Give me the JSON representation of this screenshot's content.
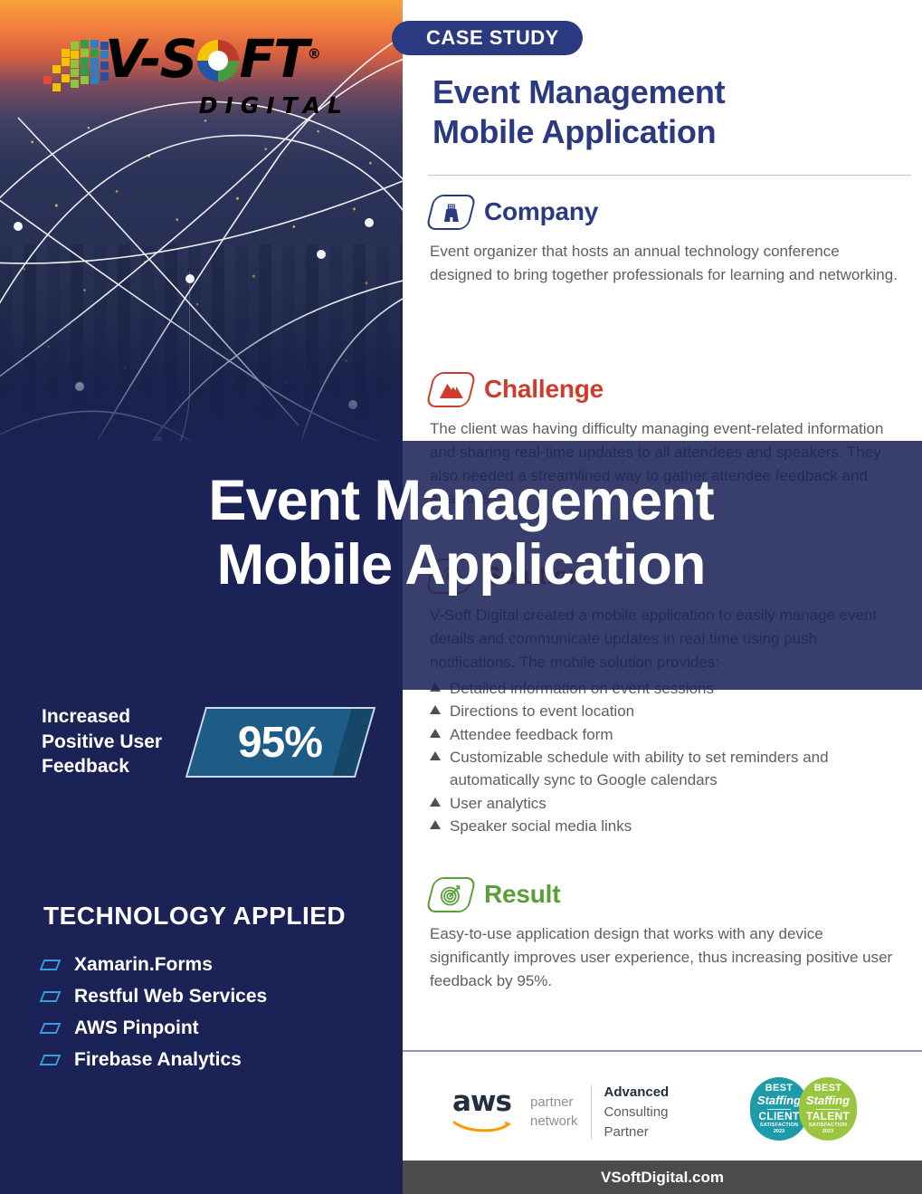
{
  "brand": {
    "logo_name": "V-SOFT",
    "logo_sub": "DIGITAL",
    "registered_mark": "®"
  },
  "overlay": {
    "title_line1": "Event Management",
    "title_line2": "Mobile Application"
  },
  "header": {
    "badge": "CASE STUDY",
    "title_line1": "Event Management",
    "title_line2": "Mobile Application"
  },
  "sections": [
    {
      "id": "company",
      "icon": "building-icon",
      "title": "Company",
      "color": "#2b3a80",
      "body": "Event organizer that hosts an annual technology conference designed to bring together professionals for learning and networking."
    },
    {
      "id": "challenge",
      "icon": "mountain-icon",
      "title": "Challenge",
      "color": "#cf3b2c",
      "body": "The client was having difficulty managing event-related information and sharing real-time updates to all attendees and speakers. They also needed a streamlined way to gather attendee feedback and analytics."
    },
    {
      "id": "solution",
      "icon": "lightbulb-icon",
      "title": "Solution",
      "color": "#d1512c",
      "body": "V-Soft Digital created a mobile application to easily manage event details and communicate updates in real time using push notifications. The mobile solution provides:"
    },
    {
      "id": "result",
      "icon": "target-icon",
      "title": "Result",
      "color": "#5a9e3a",
      "body": "Easy-to-use application design that works with any device significantly improves user experience, thus increasing positive user feedback by 95%."
    }
  ],
  "solution_bullets": [
    "Detailed information on event sessions",
    "Directions to event location",
    "Attendee feedback form",
    "Customizable schedule with ability to set reminders and automatically sync to Google calendars",
    "User analytics",
    "Speaker social media links"
  ],
  "stat": {
    "label": "Increased Positive User Feedback",
    "value": "95%"
  },
  "technology": {
    "heading": "TECHNOLOGY APPLIED",
    "items": [
      "Xamarin.Forms",
      "Restful Web Services",
      "AWS Pinpoint",
      "Firebase Analytics"
    ]
  },
  "footer": {
    "aws_wordmark": "aws",
    "aws_partner_line1": "partner",
    "aws_partner_line2": "network",
    "aws_tier_line1": "Advanced",
    "aws_tier_line2": "Consulting",
    "aws_tier_line3": "Partner",
    "badges": [
      {
        "best": "BEST",
        "of": "of",
        "staffing": "Staffing",
        "kind": "CLIENT",
        "satisfaction": "SATISFACTION",
        "year": "2023"
      },
      {
        "best": "BEST",
        "of": "of",
        "staffing": "Staffing",
        "kind": "TALENT",
        "satisfaction": "SATISFACTION",
        "year": "2023"
      }
    ],
    "url": "VSoftDigital.com"
  }
}
